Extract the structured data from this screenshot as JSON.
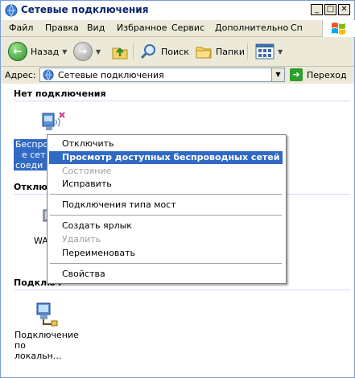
{
  "window": {
    "title": "Сетевые подключения"
  },
  "menu": {
    "items": [
      "Файл",
      "Правка",
      "Вид",
      "Избранное",
      "Сервис",
      "Дополнительно",
      "Сп"
    ]
  },
  "toolbar": {
    "back_label": "Назад",
    "search_label": "Поиск",
    "folders_label": "Папки"
  },
  "address": {
    "label": "Адрес:",
    "value": "Сетевые подключения",
    "go_label": "Переход"
  },
  "groups": {
    "none_header": "Нет подключения",
    "off_header": "Отклю",
    "on_header": "Подключ"
  },
  "connections": {
    "wireless_label_line1": "Беспро",
    "wireless_label_line2": "е сет",
    "wireless_label_line3": "соеди",
    "wan_label": "WA",
    "lan_label_line1": "Подключение",
    "lan_label_line2": "по локальн..."
  },
  "context_menu": {
    "items": [
      {
        "label": "Отключить",
        "state": "normal"
      },
      {
        "label": "Просмотр доступных беспроводных сетей",
        "state": "selected"
      },
      {
        "label": "Состояние",
        "state": "disabled"
      },
      {
        "label": "Исправить",
        "state": "normal"
      },
      {
        "label": "Подключения типа мост",
        "state": "normal"
      },
      {
        "label": "Создать ярлык",
        "state": "normal"
      },
      {
        "label": "Удалить",
        "state": "disabled"
      },
      {
        "label": "Переименовать",
        "state": "normal"
      },
      {
        "label": "Свойства",
        "state": "normal"
      }
    ]
  },
  "colors": {
    "selection": "#316ac5",
    "title_text": "#0a246a",
    "chrome": "#ece9d8"
  }
}
